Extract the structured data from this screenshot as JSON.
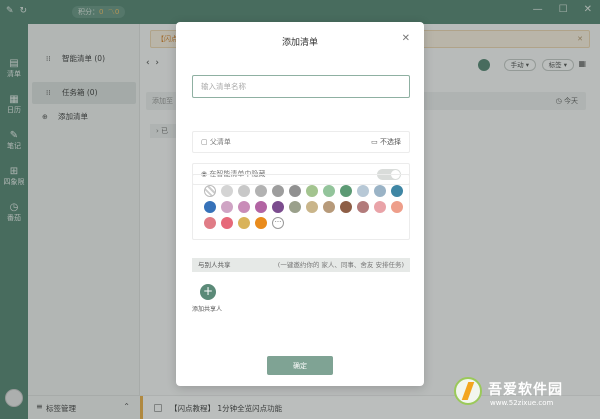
{
  "topbar": {
    "points_label": "积分：",
    "points_value": "0",
    "trend_value": "0"
  },
  "rail": {
    "items": [
      {
        "label": "清单",
        "icon": "list-icon"
      },
      {
        "label": "日历",
        "icon": "calendar-icon"
      },
      {
        "label": "笔记",
        "icon": "note-icon"
      },
      {
        "label": "四象限",
        "icon": "quadrant-icon"
      },
      {
        "label": "番茄",
        "icon": "tomato-icon"
      }
    ]
  },
  "sidebar": {
    "items": [
      {
        "label": "智能清单 (0)",
        "icon": "smart-list-icon"
      },
      {
        "label": "任务箱 (0)",
        "icon": "inbox-icon",
        "selected": true
      },
      {
        "label": "添加清单",
        "icon": "add-list-icon"
      }
    ],
    "footer_label": "标签管理"
  },
  "main": {
    "banner_text": "【闪点教程",
    "sort_label": "手动",
    "tag_label": "标签",
    "add_task_placeholder": "添加至",
    "today_label": "今天",
    "group_label": "已",
    "bottom_task": "【闪点教程】 1分钟全览闪点功能"
  },
  "modal": {
    "title": "添加清单",
    "name_placeholder": "输入清单名称",
    "parent_label": "父清单",
    "parent_value": "不选择",
    "hide_label": "在智能清单中隐藏",
    "colors": [
      "#d4d4d4",
      "#c8c8c8",
      "#b2b2b2",
      "#9d9d9d",
      "#909090",
      "#a3c48f",
      "#93c49b",
      "#5c9a74",
      "#b7c8d6",
      "#9ab3c6",
      "#3f86a4",
      "#3672b9",
      "#cfa4c4",
      "#c98cb8",
      "#b264a3",
      "#7b4c8e",
      "#9aa08b",
      "#c9b58a",
      "#b79a7a",
      "#8e5e46",
      "#b27b7b",
      "#e9a3a8",
      "#ee9e8a",
      "#e07c86",
      "#e6697a",
      "#d9b35a",
      "#e98b1c"
    ],
    "share_title": "与别人共享",
    "share_hint": "(一键邀约你的 家人、同事、舍友 安排任务)",
    "add_share_label": "添加共享人",
    "confirm_label": "确定"
  },
  "watermark": {
    "brand": "吾爱软件园",
    "url": "www.52zixue.com"
  }
}
